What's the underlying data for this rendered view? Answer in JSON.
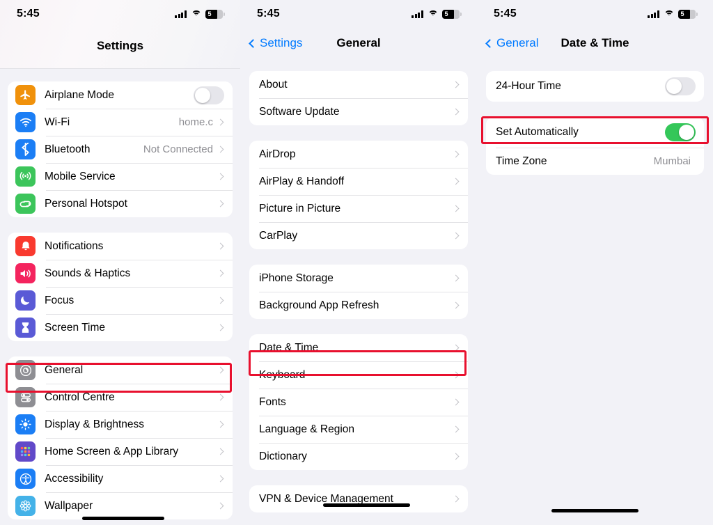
{
  "panels": [
    {
      "id": "settings",
      "status": {
        "time": "5:45",
        "battery_level": "5",
        "cellular_icon": "cellular-bars-icon",
        "wifi_icon": "wifi-icon",
        "battery_icon": "battery-icon"
      },
      "nav": {
        "title": "Settings",
        "back_label": ""
      },
      "groups": [
        {
          "rows": [
            {
              "label": "Airplane Mode",
              "icon": "airplane-icon",
              "icon_color": "#f0910b",
              "accessory": "toggle",
              "toggle_on": false
            },
            {
              "label": "Wi-Fi",
              "icon": "wifi-icon",
              "icon_color": "#1b7ef5",
              "value": "home.c",
              "accessory": "chevron"
            },
            {
              "label": "Bluetooth",
              "icon": "bluetooth-icon",
              "icon_color": "#1b7ef5",
              "value": "Not Connected",
              "accessory": "chevron"
            },
            {
              "label": "Mobile Service",
              "icon": "antenna-icon",
              "icon_color": "#3cc55b",
              "accessory": "chevron"
            },
            {
              "label": "Personal Hotspot",
              "icon": "hotspot-link-icon",
              "icon_color": "#3cc55b",
              "accessory": "chevron"
            }
          ]
        },
        {
          "rows": [
            {
              "label": "Notifications",
              "icon": "bell-icon",
              "icon_color": "#f93a2f",
              "accessory": "chevron"
            },
            {
              "label": "Sounds & Haptics",
              "icon": "speaker-icon",
              "icon_color": "#f4245e",
              "accessory": "chevron"
            },
            {
              "label": "Focus",
              "icon": "moon-icon",
              "icon_color": "#5a5ad6",
              "accessory": "chevron"
            },
            {
              "label": "Screen Time",
              "icon": "hourglass-icon",
              "icon_color": "#5a5ad6",
              "accessory": "chevron"
            }
          ]
        },
        {
          "rows": [
            {
              "label": "General",
              "icon": "gear-icon",
              "icon_color": "#8e8e93",
              "accessory": "chevron",
              "highlighted": true
            },
            {
              "label": "Control Centre",
              "icon": "sliders-icon",
              "icon_color": "#8e8e93",
              "accessory": "chevron"
            },
            {
              "label": "Display & Brightness",
              "icon": "brightness-icon",
              "icon_color": "#1b7ef5",
              "accessory": "chevron"
            },
            {
              "label": "Home Screen & App Library",
              "icon": "app-grid-icon",
              "icon_color": "#6149c9",
              "accessory": "chevron"
            },
            {
              "label": "Accessibility",
              "icon": "accessibility-icon",
              "icon_color": "#1b7ef5",
              "accessory": "chevron"
            },
            {
              "label": "Wallpaper",
              "icon": "flower-icon",
              "icon_color": "#44b2e8",
              "accessory": "chevron"
            }
          ]
        }
      ]
    },
    {
      "id": "general",
      "status": {
        "time": "5:45",
        "battery_level": "5"
      },
      "nav": {
        "title": "General",
        "back_label": "Settings"
      },
      "groups": [
        {
          "rows": [
            {
              "label": "About",
              "accessory": "chevron"
            },
            {
              "label": "Software Update",
              "accessory": "chevron"
            }
          ]
        },
        {
          "rows": [
            {
              "label": "AirDrop",
              "accessory": "chevron"
            },
            {
              "label": "AirPlay & Handoff",
              "accessory": "chevron"
            },
            {
              "label": "Picture in Picture",
              "accessory": "chevron"
            },
            {
              "label": "CarPlay",
              "accessory": "chevron"
            }
          ]
        },
        {
          "rows": [
            {
              "label": "iPhone Storage",
              "accessory": "chevron"
            },
            {
              "label": "Background App Refresh",
              "accessory": "chevron"
            }
          ]
        },
        {
          "rows": [
            {
              "label": "Date & Time",
              "accessory": "chevron",
              "highlighted": true
            },
            {
              "label": "Keyboard",
              "accessory": "chevron"
            },
            {
              "label": "Fonts",
              "accessory": "chevron"
            },
            {
              "label": "Language & Region",
              "accessory": "chevron"
            },
            {
              "label": "Dictionary",
              "accessory": "chevron"
            }
          ]
        },
        {
          "rows": [
            {
              "label": "VPN & Device Management",
              "accessory": "chevron"
            }
          ]
        }
      ]
    },
    {
      "id": "date-time",
      "status": {
        "time": "5:45",
        "battery_level": "5"
      },
      "nav": {
        "title": "Date & Time",
        "back_label": "General"
      },
      "groups": [
        {
          "rows": [
            {
              "label": "24-Hour Time",
              "accessory": "toggle",
              "toggle_on": false
            }
          ]
        },
        {
          "rows": [
            {
              "label": "Set Automatically",
              "accessory": "toggle",
              "toggle_on": true,
              "highlighted": true
            },
            {
              "label": "Time Zone",
              "value": "Mumbai",
              "accessory": "none"
            }
          ]
        }
      ]
    }
  ],
  "colors": {
    "highlight": "#e8102e",
    "accent_blue": "#007aff",
    "toggle_on": "#34c759",
    "group_bg": "#ffffff",
    "page_bg": "#f2f2f7",
    "secondary_text": "#8e8e93"
  }
}
